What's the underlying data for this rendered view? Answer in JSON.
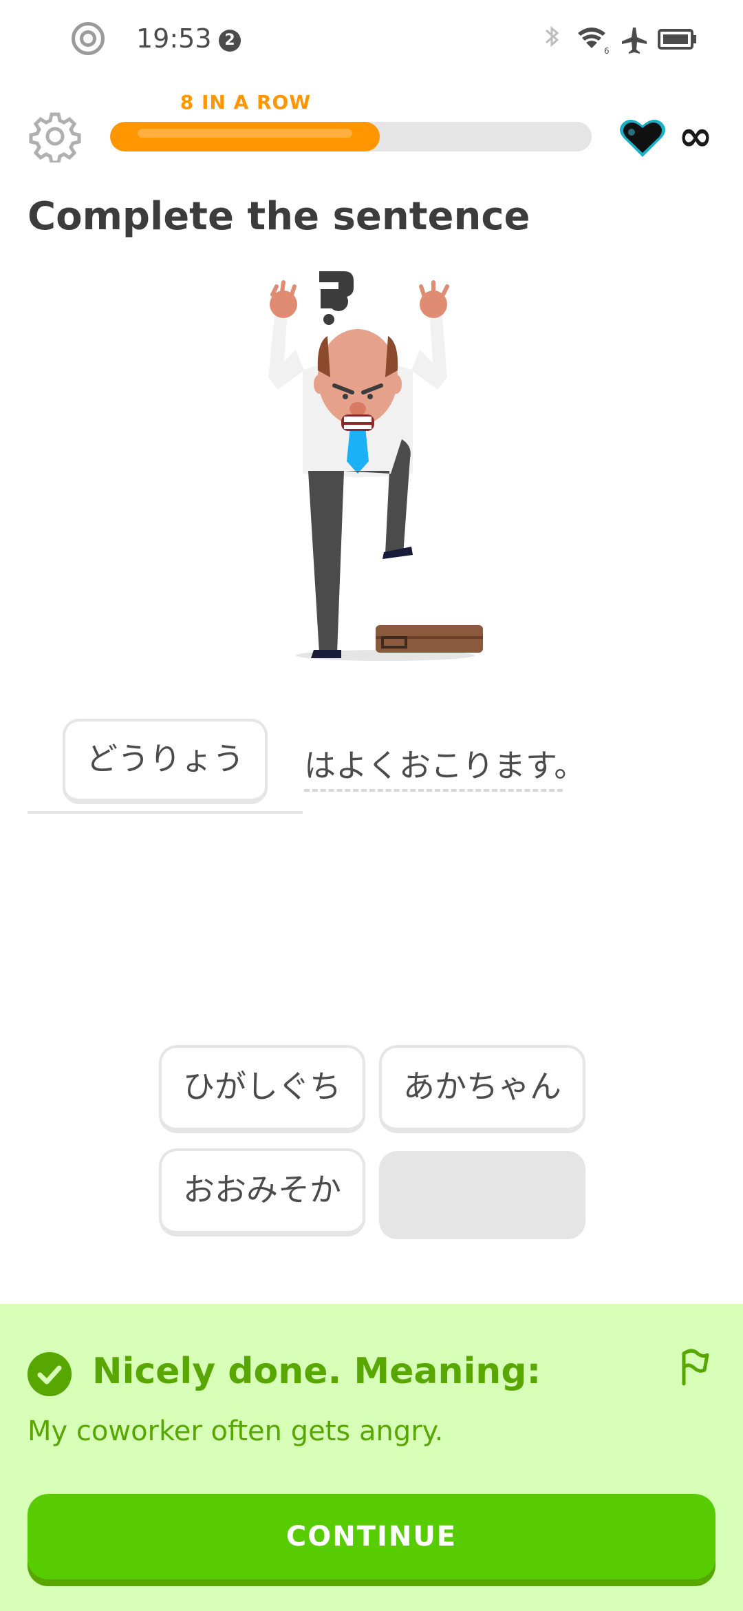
{
  "status_bar": {
    "time": "19:53",
    "notification_count": "2"
  },
  "header": {
    "streak_label": "8 IN A ROW",
    "progress": 0.56,
    "hearts": "∞"
  },
  "exercise": {
    "title": "Complete the sentence",
    "chosen_word": "どうりょう",
    "sentence_rest": "はよくおこります。"
  },
  "word_bank": [
    {
      "label": "ひがしぐち"
    },
    {
      "label": "あかちゃん"
    },
    {
      "label": "おおみそか"
    },
    {
      "label": ""
    }
  ],
  "feedback": {
    "title": "Nicely done. Meaning:",
    "meaning": "My coworker often gets angry.",
    "continue_label": "CONTINUE"
  },
  "colors": {
    "accent": "#58cc02",
    "streak": "#ff9600",
    "feedback_bg": "#d7ffb8",
    "feedback_text": "#58a700"
  },
  "icons": [
    "target-icon",
    "gear-icon",
    "heart-icon",
    "check-icon",
    "flag-icon",
    "bluetooth-icon",
    "wifi-icon",
    "airplane-icon",
    "battery-icon"
  ]
}
